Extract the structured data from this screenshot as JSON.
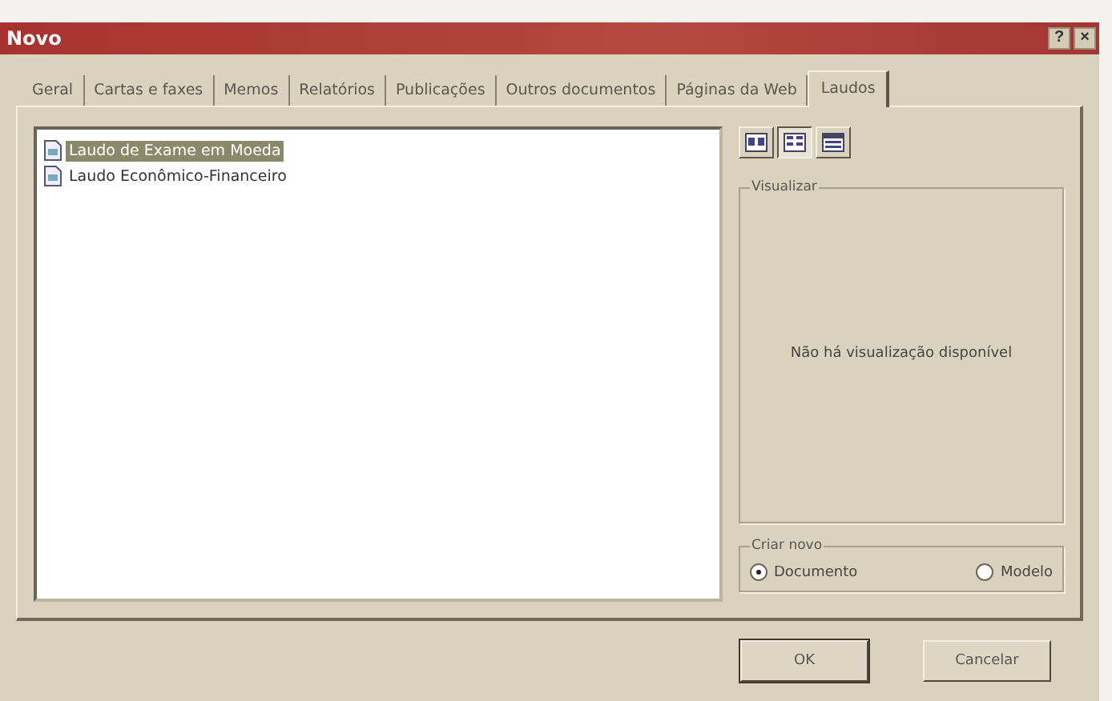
{
  "window": {
    "title": "Novo"
  },
  "title_buttons": [
    "?",
    "×"
  ],
  "tabs": [
    {
      "label": "Geral",
      "selected": false
    },
    {
      "label": "Cartas e faxes",
      "selected": false
    },
    {
      "label": "Memos",
      "selected": false
    },
    {
      "label": "Relatórios",
      "selected": false
    },
    {
      "label": "Publicações",
      "selected": false
    },
    {
      "label": "Outros documentos",
      "selected": false
    },
    {
      "label": "Páginas da Web",
      "selected": false
    },
    {
      "label": "Laudos",
      "selected": true
    }
  ],
  "templates": [
    {
      "name": "Laudo de Exame em Moeda",
      "selected": true
    },
    {
      "name": "Laudo Econômico-Financeiro",
      "selected": false
    }
  ],
  "view_buttons": [
    {
      "kind": "large",
      "selected": false
    },
    {
      "kind": "list",
      "selected": true
    },
    {
      "kind": "details",
      "selected": false
    }
  ],
  "preview": {
    "label": "Visualizar",
    "message": "Não há visualização disponível"
  },
  "create_new": {
    "label": "Criar novo",
    "options": [
      {
        "label": "Documento",
        "selected": true
      },
      {
        "label": "Modelo",
        "selected": false
      }
    ]
  },
  "buttons": [
    "OK",
    "Cancelar"
  ]
}
